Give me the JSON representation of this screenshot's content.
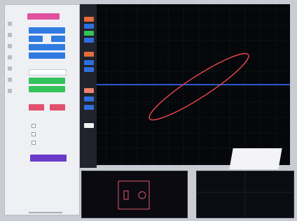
{
  "colors": {
    "panel_bg": "#eef0f4",
    "plot_bg": "#05070a",
    "grid": "#1f4a2a",
    "ellipse": "#e0424d",
    "hline": "#2b57d6",
    "pink_button": "#e0519e",
    "blue_button": "#2f7be2",
    "green_button": "#34c25a",
    "red_button": "#e2506e",
    "purple_button": "#6a3ac8"
  },
  "panel": {
    "top_pink_label": "",
    "blue_row_labels": [
      "",
      "",
      "",
      ""
    ],
    "header_label": "",
    "green_buttons": [
      "",
      ""
    ],
    "red_buttons": [
      "",
      ""
    ],
    "checkboxes": [
      "",
      "",
      ""
    ],
    "purple_label": ""
  },
  "plot": {
    "grid": true,
    "trace": "ellipse",
    "h_line": true
  },
  "mini1": {
    "lines": [
      "",
      ""
    ]
  },
  "mini2": {
    "label": ""
  }
}
